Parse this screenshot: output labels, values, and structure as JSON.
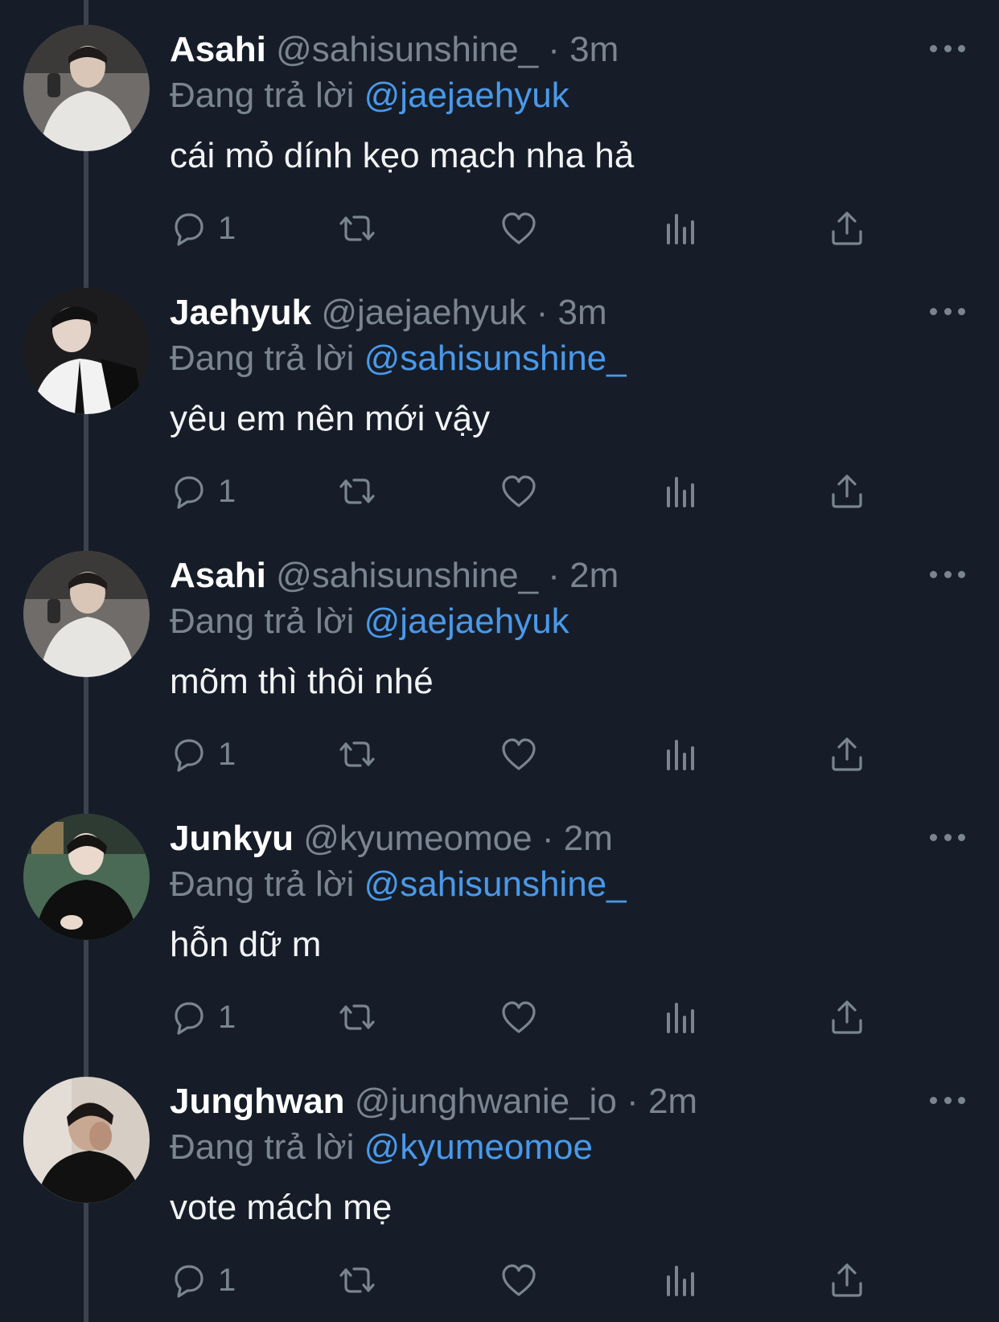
{
  "reply_prefix": "Đang trả lời",
  "colors": {
    "background": "#161d28",
    "mention": "#4a99e9",
    "muted": "#7a8591"
  },
  "tweets": [
    {
      "name": "Asahi",
      "handle": "@sahisunshine_",
      "separator": "·",
      "time": "3m",
      "replying_to": "@jaejaehyuk",
      "text": "cái mỏ dính kẹo mạch nha hả",
      "reply_count": "1",
      "avatar_icon": "avatar-asahi"
    },
    {
      "name": "Jaehyuk",
      "handle": "@jaejaehyuk",
      "separator": "·",
      "time": "3m",
      "replying_to": "@sahisunshine_",
      "text": "yêu em nên mới vậy",
      "reply_count": "1",
      "avatar_icon": "avatar-jaehyuk"
    },
    {
      "name": "Asahi",
      "handle": "@sahisunshine_",
      "separator": "·",
      "time": "2m",
      "replying_to": "@jaejaehyuk",
      "text": "mõm thì thôi nhé",
      "reply_count": "1",
      "avatar_icon": "avatar-asahi"
    },
    {
      "name": "Junkyu",
      "handle": "@kyumeomoe",
      "separator": "·",
      "time": "2m",
      "replying_to": "@sahisunshine_",
      "text": "hỗn dữ m",
      "reply_count": "1",
      "avatar_icon": "avatar-junkyu"
    },
    {
      "name": "Junghwan",
      "handle": "@junghwanie_io",
      "separator": "·",
      "time": "2m",
      "replying_to": "@kyumeomoe",
      "text": "vote mách mẹ",
      "reply_count": "1",
      "avatar_icon": "avatar-junghwan"
    }
  ]
}
